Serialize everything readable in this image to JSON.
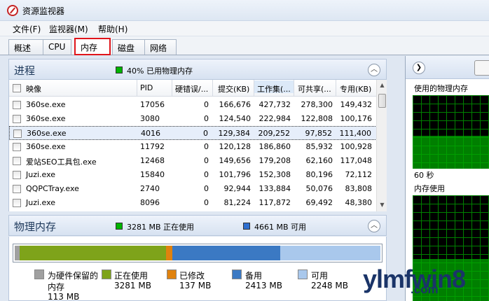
{
  "window": {
    "title": "资源监视器"
  },
  "menu": [
    "文件(F)",
    "监视器(M)",
    "帮助(H)"
  ],
  "tabs": [
    "概述",
    "CPU",
    "内存",
    "磁盘",
    "网络"
  ],
  "active_tab": "内存",
  "processes": {
    "title": "进程",
    "legend_text": "40% 已用物理内存",
    "legend_color": "#00b400",
    "columns": [
      "映像",
      "PID",
      "硬错误/...",
      "提交(KB)",
      "工作集(...",
      "可共享(...",
      "专用(KB)"
    ],
    "rows": [
      [
        "360se.exe",
        "17056",
        "0",
        "166,676",
        "427,732",
        "278,300",
        "149,432"
      ],
      [
        "360se.exe",
        "3080",
        "0",
        "124,540",
        "222,984",
        "122,808",
        "100,176"
      ],
      [
        "360se.exe",
        "4016",
        "0",
        "129,384",
        "209,252",
        "97,852",
        "111,400"
      ],
      [
        "360se.exe",
        "11792",
        "0",
        "120,128",
        "186,860",
        "85,932",
        "100,928"
      ],
      [
        "爱站SEO工具包.exe",
        "12468",
        "0",
        "149,656",
        "179,208",
        "62,160",
        "117,048"
      ],
      [
        "Juzi.exe",
        "15840",
        "0",
        "101,796",
        "152,308",
        "80,196",
        "72,112"
      ],
      [
        "QQPCTray.exe",
        "2740",
        "0",
        "92,944",
        "133,884",
        "50,076",
        "83,808"
      ],
      [
        "Juzi.exe",
        "8096",
        "0",
        "81,224",
        "117,872",
        "69,492",
        "48,380"
      ]
    ],
    "selected_row": 2
  },
  "physical_memory": {
    "title": "物理内存",
    "in_use_text": "3281 MB 正在使用",
    "available_text": "4661 MB 可用",
    "bar_mb": {
      "reserved": 113,
      "in_use": 3281,
      "modified": 137,
      "standby": 2413,
      "free": 2248
    },
    "colors": {
      "reserved": "#a0a0a0",
      "in_use": "#7ea31a",
      "modified": "#e0820e",
      "standby": "#3b79c3",
      "free": "#a9c8ec"
    },
    "legend": [
      {
        "label": "为硬件保留的",
        "label2": "内存",
        "value": "113 MB"
      },
      {
        "label": "正在使用",
        "value": "3281 MB"
      },
      {
        "label": "已修改",
        "value": "137 MB"
      },
      {
        "label": "备用",
        "value": "2413 MB"
      },
      {
        "label": "可用",
        "value": "2248 MB"
      }
    ]
  },
  "graphs": {
    "top_label": "使用的物理内存",
    "time_label": "60 秒",
    "bottom_label": "内存使用",
    "fill_level": 0.45
  },
  "watermark": {
    "text": "ylmfwin8",
    "sub": ".com"
  }
}
